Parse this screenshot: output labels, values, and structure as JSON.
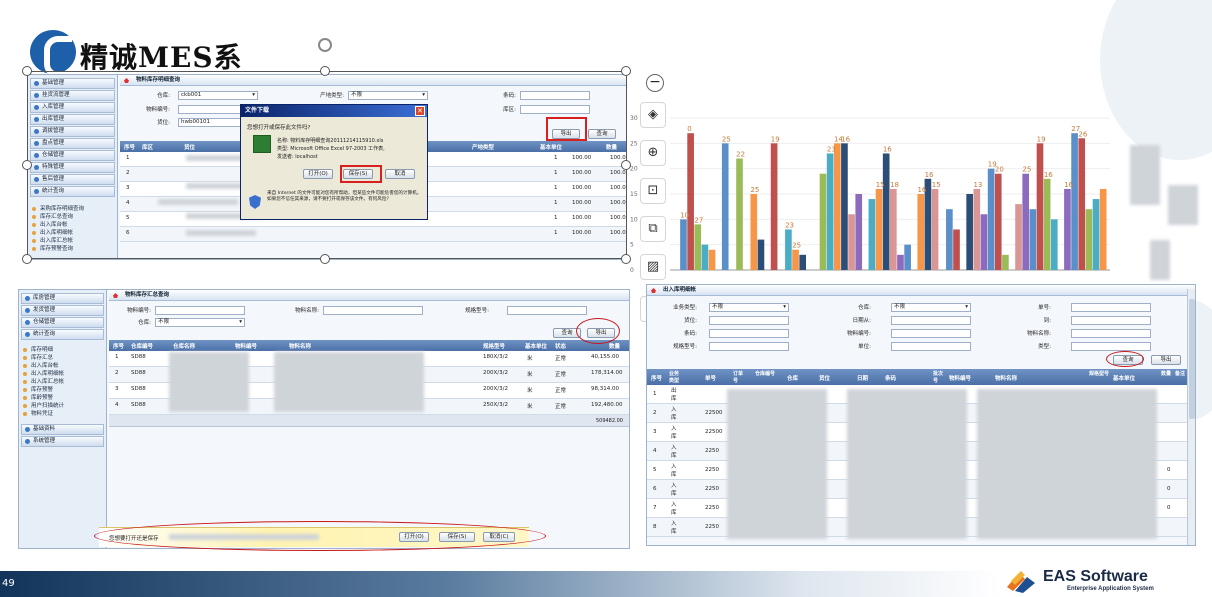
{
  "page_number": "49",
  "logo": {
    "text": "精诚MES系统"
  },
  "brand": {
    "name": "EAS Software",
    "tagline": "Enterprise Application System"
  },
  "panel1": {
    "title": "物料库存明细查询",
    "sidebar": [
      "基础管理",
      "挂货流管理",
      "入库管理",
      "出库管理",
      "调拨管理",
      "盘点管理",
      "仓储管理",
      "特殊管理",
      "售后管理",
      "统计查询"
    ],
    "subitems": [
      "采购库存明细查询",
      "库存汇总查询",
      "出入库台帐",
      "出入库明细帐",
      "出入库汇总帐",
      "库存预警查询"
    ],
    "fields": {
      "warehouse_label": "仓库:",
      "warehouse_value": "ckb001",
      "origin_label": "产地类型:",
      "origin_value": "不限",
      "barcode_label": "条码:",
      "code_label": "物料编号:",
      "region_label": "库区:",
      "loc_label": "货位:",
      "loc_value": "hwb00101"
    },
    "buttons": {
      "export": "导出",
      "query": "查询"
    },
    "columns": [
      "序号",
      "库区",
      "货位",
      "产地类型",
      "基本单位",
      "数量"
    ],
    "rows": [
      {
        "n": "1",
        "q": "1",
        "v": "100.00"
      },
      {
        "n": "2",
        "q": "1",
        "v": "100.00"
      },
      {
        "n": "3",
        "q": "1",
        "v": "100.00"
      },
      {
        "n": "4",
        "q": "1",
        "v": "100.00"
      },
      {
        "n": "5",
        "q": "1",
        "v": "100.00"
      },
      {
        "n": "6",
        "q": "1",
        "v": "100.00"
      }
    ],
    "dialog": {
      "title": "文件下载",
      "question": "您想打开或保存此文件吗?",
      "name": "名称:  物料库存明细查询20111214115910.xls",
      "type": "类型:  Microsoft Office Excel 97-2003 工作表,",
      "from": "发送者: localhost",
      "open": "打开(O)",
      "save": "保存(S)",
      "cancel": "取消",
      "warn": "来自 Internet 的文件可能对您有所帮助，但某些文件可能危害您的计算机。如果您不信任其来源，请不要打开或保存该文件。有何风险?"
    }
  },
  "panel2": {
    "title": "物料库存汇总查询",
    "sidebar_top": [
      "库房管理",
      "发货管理",
      "仓储管理",
      "统计查询"
    ],
    "subitems": [
      "库存明细",
      "库存汇总",
      "出入库台帐",
      "出入库明细帐",
      "出入库汇总帐",
      "库存预警",
      "库龄预警",
      "用户扫描统计",
      "物料凭证"
    ],
    "sidebar_bottom": [
      "基础资料",
      "系统管理"
    ],
    "fields": {
      "code_label": "物料编号:",
      "name_label": "物料名称:",
      "spec_label": "规格型号:",
      "wh_label": "仓库:",
      "wh_value": "不限"
    },
    "buttons": {
      "query": "查询",
      "export": "导出"
    },
    "columns": [
      "序号",
      "仓库编号",
      "仓库名称",
      "物料编号",
      "物料名称",
      "规格型号",
      "基本单位",
      "状态",
      "数量"
    ],
    "rows": [
      {
        "n": "1",
        "wh": "SD88",
        "spec": "180X/3/2",
        "unit": "米",
        "state": "正常",
        "qty": "40,155.00"
      },
      {
        "n": "2",
        "wh": "SD88",
        "spec": "200X/3/2",
        "unit": "米",
        "state": "正常",
        "qty": "178,314.00"
      },
      {
        "n": "3",
        "wh": "SD88",
        "spec": "200X/3/2",
        "unit": "米",
        "state": "正常",
        "qty": "98,314.00"
      },
      {
        "n": "4",
        "wh": "SD88",
        "spec": "250X/3/2",
        "unit": "米",
        "state": "正常",
        "qty": "192,480.00"
      }
    ],
    "total": "509482.00",
    "download_bar": {
      "text": "您想要打开还是保存",
      "open": "打开(O)",
      "save": "保存(S)",
      "cancel": "取消(C)"
    }
  },
  "chart_data": {
    "type": "bar",
    "ylim": [
      0,
      30
    ],
    "yticks": [
      "0",
      "5",
      "10",
      "15",
      "20",
      "25",
      "30"
    ],
    "groups": [
      [
        0,
        10,
        27,
        9,
        5,
        4
      ],
      [
        25,
        0,
        22,
        0,
        15,
        6
      ],
      [
        25,
        0,
        8,
        4,
        3,
        0
      ],
      [
        19,
        23,
        25,
        25,
        11,
        15
      ],
      [
        14,
        16,
        23,
        16,
        3,
        5
      ],
      [
        15,
        18,
        16,
        0,
        12,
        8
      ],
      [
        15,
        16,
        11,
        20,
        19,
        3
      ],
      [
        13,
        19,
        12,
        25,
        18,
        10
      ],
      [
        16,
        27,
        26,
        12,
        14,
        16
      ]
    ],
    "value_labels": [
      "0",
      "10",
      "27",
      "25",
      "22",
      "25",
      "19",
      "23",
      "25",
      "14",
      "16",
      "23",
      "16",
      "15",
      "18",
      "16",
      "15",
      "16",
      "19",
      "20",
      "13",
      "19",
      "25",
      "16",
      "27",
      "26",
      "16"
    ],
    "colors": [
      "#8c6bbf",
      "#5b8fc9",
      "#c0504d",
      "#9bbb59",
      "#4bacc6",
      "#f79646",
      "#2c4d75",
      "#d99694"
    ]
  },
  "viewer_tools": [
    "zoom-out",
    "layers",
    "zoom-in",
    "crop",
    "scan",
    "image-edit",
    "more"
  ],
  "panel3": {
    "title": "出入库明细帐",
    "fields": {
      "type_label": "业务类型:",
      "type_value": "不限",
      "wh_label": "仓库:",
      "wh_value": "不限",
      "doc_label": "单号:",
      "loc_label": "货位:",
      "date_label": "日期从:",
      "to_label": "到:",
      "barcode_label": "条码:",
      "code_label": "物料编号:",
      "mname_label": "物料名称:",
      "spec_label": "规格型号:",
      "unit_label": "单位:",
      "cat_label": "类型:"
    },
    "buttons": {
      "query": "查询",
      "export": "导出"
    },
    "columns": [
      "序号",
      "业务类型",
      "单号",
      "订单号",
      "仓库编号",
      "仓库",
      "货位",
      "日期",
      "条码",
      "批次号",
      "物料编号",
      "物料名称",
      "规格型号",
      "基本单位",
      "数量",
      "备注"
    ],
    "rows": [
      {
        "n": "1",
        "t": "出库",
        "d": "",
        "q": ""
      },
      {
        "n": "2",
        "t": "入库",
        "d": "22500",
        "q": ""
      },
      {
        "n": "3",
        "t": "入库",
        "d": "22500",
        "q": ""
      },
      {
        "n": "4",
        "t": "入库",
        "d": "2250",
        "q": ""
      },
      {
        "n": "5",
        "t": "入库",
        "d": "2250",
        "q": "0"
      },
      {
        "n": "6",
        "t": "入库",
        "d": "2250",
        "q": "0"
      },
      {
        "n": "7",
        "t": "入库",
        "d": "2250",
        "q": "0"
      },
      {
        "n": "8",
        "t": "入库",
        "d": "2250",
        "q": ""
      }
    ]
  }
}
